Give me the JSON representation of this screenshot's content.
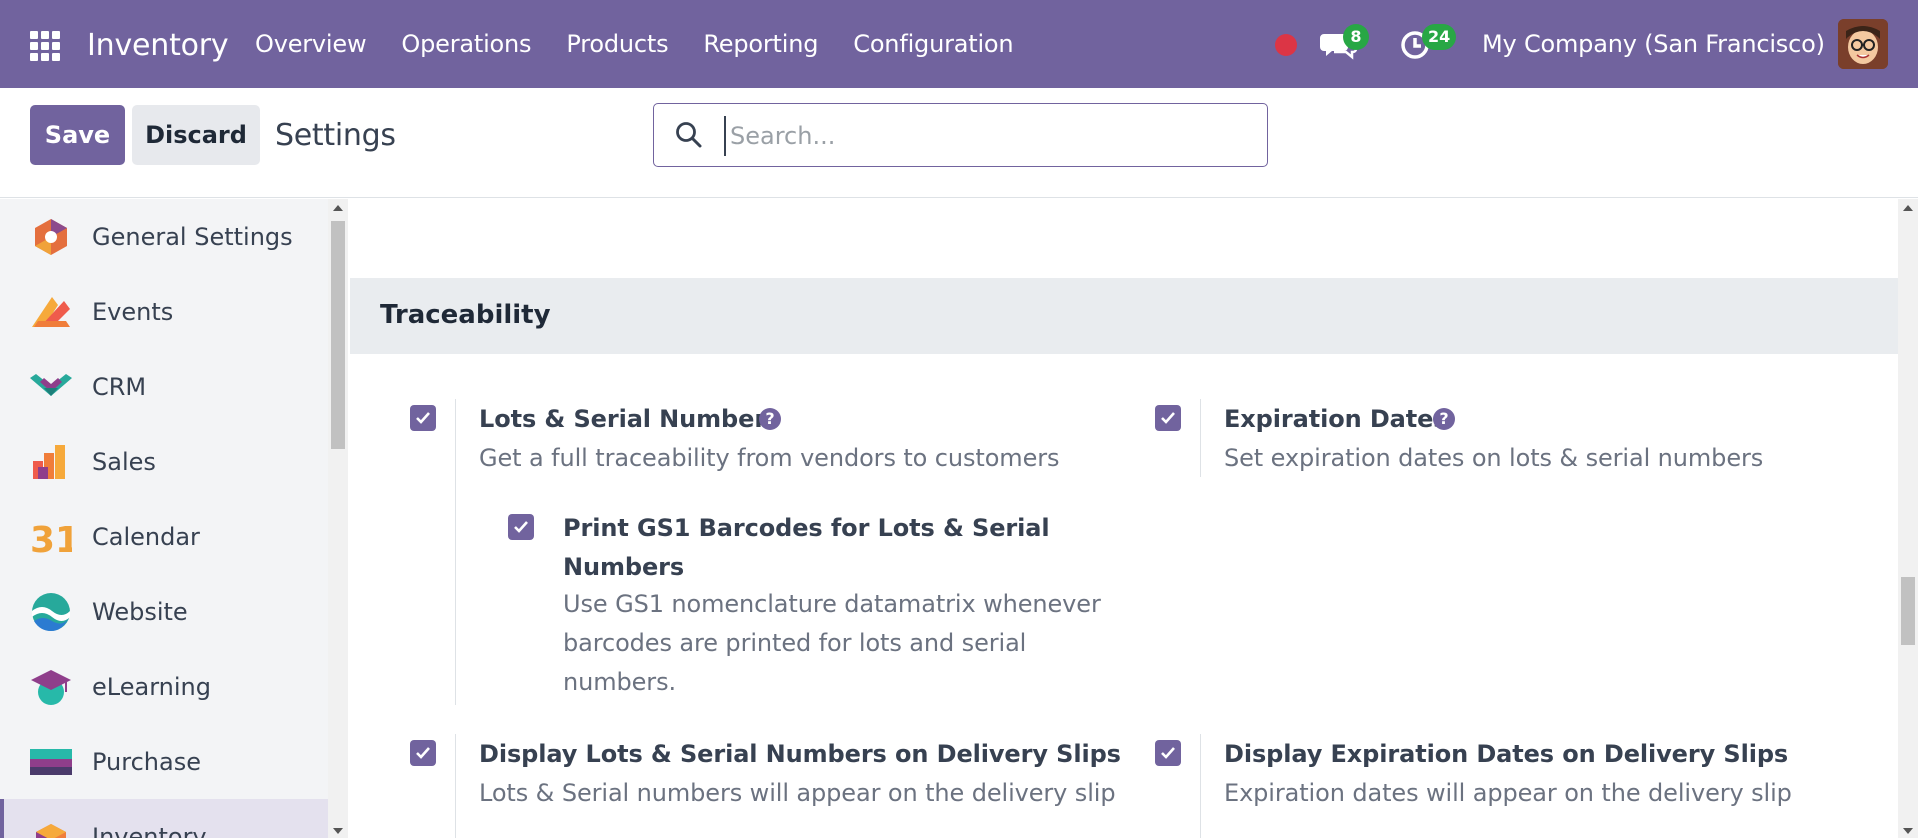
{
  "navbar": {
    "brand": "Inventory",
    "menu": [
      "Overview",
      "Operations",
      "Products",
      "Reporting",
      "Configuration"
    ],
    "chat_badge": "8",
    "activity_badge": "24",
    "company": "My Company (San Francisco)",
    "colors": {
      "bar": "#71639e",
      "badge": "#28a745",
      "record": "#dc3545"
    }
  },
  "control": {
    "save_label": "Save",
    "discard_label": "Discard",
    "breadcrumb": "Settings",
    "search_placeholder": "Search..."
  },
  "sidebar": {
    "items": [
      {
        "label": "General Settings",
        "icon": "general-settings-icon"
      },
      {
        "label": "Events",
        "icon": "events-icon"
      },
      {
        "label": "CRM",
        "icon": "crm-icon"
      },
      {
        "label": "Sales",
        "icon": "sales-icon"
      },
      {
        "label": "Calendar",
        "icon": "calendar-icon",
        "icon_text": "31"
      },
      {
        "label": "Website",
        "icon": "website-icon"
      },
      {
        "label": "eLearning",
        "icon": "elearning-icon"
      },
      {
        "label": "Purchase",
        "icon": "purchase-icon"
      },
      {
        "label": "Inventory",
        "icon": "inventory-icon",
        "active": true
      }
    ]
  },
  "main": {
    "section_title": "Traceability",
    "settings": {
      "lots": {
        "title": "Lots & Serial Numbers",
        "desc": "Get a full traceability from vendors to customers",
        "checked": true
      },
      "expiration": {
        "title": "Expiration Dates",
        "desc": "Set expiration dates on lots & serial numbers",
        "checked": true
      },
      "gs1": {
        "title_line1": "Print GS1 Barcodes for Lots & Serial",
        "title_line2": "Numbers",
        "desc_line1": "Use GS1 nomenclature datamatrix whenever",
        "desc_line2": "barcodes are printed for lots and serial",
        "desc_line3": "numbers.",
        "checked": true
      },
      "display_lots": {
        "title": "Display Lots & Serial Numbers on Delivery Slips",
        "desc": "Lots & Serial numbers will appear on the delivery slip",
        "checked": true
      },
      "display_exp": {
        "title": "Display Expiration Dates on Delivery Slips",
        "desc": "Expiration dates will appear on the delivery slip",
        "checked": true
      }
    },
    "help_glyph": "?"
  }
}
